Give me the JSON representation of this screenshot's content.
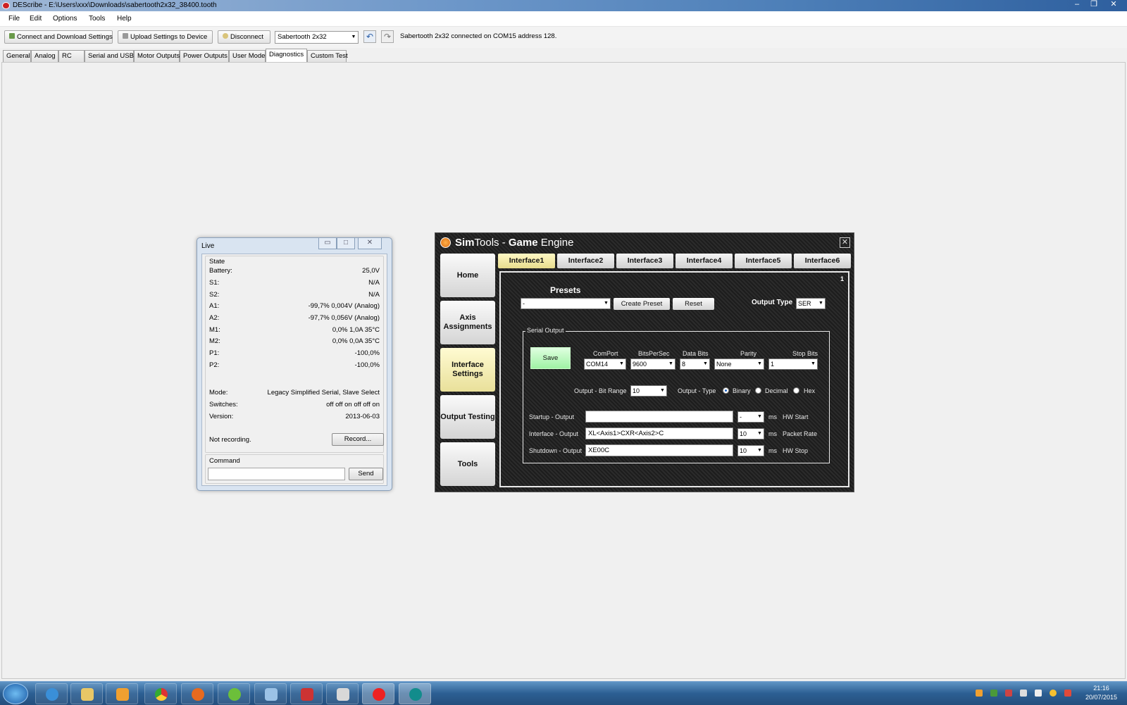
{
  "window": {
    "title": "DEScribe - E:\\Users\\xxx\\Downloads\\sabertooth2x32_38400.tooth"
  },
  "menu": [
    "File",
    "Edit",
    "Options",
    "Tools",
    "Help"
  ],
  "toolbar": {
    "connect": "Connect and Download Settings",
    "upload": "Upload Settings to Device",
    "disconnect": "Disconnect",
    "device": "Sabertooth 2x32",
    "status": "Sabertooth 2x32 connected on COM15 address 128."
  },
  "tabs": [
    "General",
    "Analog",
    "RC",
    "Serial and USB",
    "Motor Outputs",
    "Power Outputs",
    "User Mode",
    "Diagnostics",
    "Custom Test"
  ],
  "live": {
    "title": "Live",
    "state_label": "State",
    "rows": [
      {
        "k": "Battery:",
        "v": "25,0V"
      },
      {
        "k": "S1:",
        "v": "N/A"
      },
      {
        "k": "S2:",
        "v": "N/A"
      },
      {
        "k": "A1:",
        "v": "-99,7% 0,004V  (Analog)"
      },
      {
        "k": "A2:",
        "v": "-97,7% 0,056V  (Analog)"
      },
      {
        "k": "M1:",
        "v": "0,0% 1,0A 35°C"
      },
      {
        "k": "M2:",
        "v": "0,0% 0,0A 35°C"
      },
      {
        "k": "P1:",
        "v": "-100,0%"
      },
      {
        "k": "P2:",
        "v": "-100,0%"
      }
    ],
    "info": [
      {
        "k": "Mode:",
        "v": "Legacy Simplified Serial, Slave Select"
      },
      {
        "k": "Switches:",
        "v": "off off on off off on"
      },
      {
        "k": "Version:",
        "v": "2013-06-03"
      }
    ],
    "recording": "Not recording.",
    "record_btn": "Record...",
    "command_label": "Command",
    "send_btn": "Send"
  },
  "sim": {
    "title_a": "Sim",
    "title_b": "Tools - ",
    "title_c": "Game",
    "title_d": " Engine",
    "nav": [
      "Home",
      "Axis Assignments",
      "Interface Settings",
      "Output Testing",
      "Tools"
    ],
    "interfaces": [
      "Interface1",
      "Interface2",
      "Interface3",
      "Interface4",
      "Interface5",
      "Interface6"
    ],
    "panel_number": "1",
    "presets_label": "Presets",
    "preset_value": "-",
    "create_preset": "Create Preset",
    "reset": "Reset",
    "output_type_label": "Output Type",
    "output_type_value": "SER",
    "serial_output": "Serial Output",
    "save": "Save",
    "comport_label": "ComPort",
    "comport_value": "COM14",
    "bps_label": "BitsPerSec",
    "bps_value": "9600",
    "databits_label": "Data Bits",
    "databits_value": "8",
    "parity_label": "Parity",
    "parity_value": "None",
    "stopbits_label": "Stop Bits",
    "stopbits_value": "1",
    "bitrange_label": "Output - Bit Range",
    "bitrange_value": "10",
    "outtype_label": "Output - Type",
    "binary": "Binary",
    "decimal": "Decimal",
    "hex": "Hex",
    "startup_label": "Startup - Output",
    "startup_value": "",
    "startup_ms": "-",
    "hw_start": "HW Start",
    "interface_label": "Interface - Output",
    "interface_value": "XL<Axis1>CXR<Axis2>C",
    "interface_ms": "10",
    "packet_rate": "Packet Rate",
    "shutdown_label": "Shutdown - Output",
    "shutdown_value": "XE00C",
    "shutdown_ms": "10",
    "hw_stop": "HW Stop",
    "ms": "ms"
  },
  "taskbar": {
    "time": "21:16",
    "date": "20/07/2015"
  }
}
